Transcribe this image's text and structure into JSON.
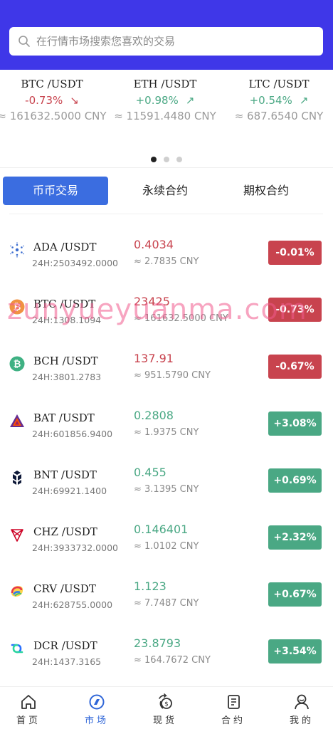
{
  "search": {
    "placeholder": "在行情市场搜索您喜欢的交易"
  },
  "tickers": [
    {
      "pair": "BTC /USDT",
      "change": "-0.73%",
      "direction": "down",
      "cny": "≈ 161632.5000 CNY"
    },
    {
      "pair": "ETH /USDT",
      "change": "+0.98%",
      "direction": "up",
      "cny": "≈ 11591.4480 CNY"
    },
    {
      "pair": "LTC /USDT",
      "change": "+0.54%",
      "direction": "up",
      "cny": "≈ 687.6540 CNY"
    }
  ],
  "tabs": [
    {
      "label": "币币交易",
      "active": true
    },
    {
      "label": "永续合约",
      "active": false
    },
    {
      "label": "期权合约",
      "active": false
    }
  ],
  "coins": [
    {
      "icon": "cardano-icon",
      "name": "ADA /USDT",
      "vol": "24H:2503492.0000",
      "price": "0.4034",
      "cny": "≈ 2.7835 CNY",
      "change": "-0.01%",
      "up": false
    },
    {
      "icon": "bitcoin-icon",
      "name": "BTC /USDT",
      "vol": "24H:1308.1094",
      "price": "23425",
      "cny": "≈ 161632.5000 CNY",
      "change": "-0.73%",
      "up": false
    },
    {
      "icon": "bitcoin-cash-icon",
      "name": "BCH /USDT",
      "vol": "24H:3801.2783",
      "price": "137.91",
      "cny": "≈ 951.5790 CNY",
      "change": "-0.67%",
      "up": false
    },
    {
      "icon": "bat-icon",
      "name": "BAT /USDT",
      "vol": "24H:601856.9400",
      "price": "0.2808",
      "cny": "≈ 1.9375 CNY",
      "change": "+3.08%",
      "up": true
    },
    {
      "icon": "bancor-icon",
      "name": "BNT /USDT",
      "vol": "24H:69921.1400",
      "price": "0.455",
      "cny": "≈ 3.1395 CNY",
      "change": "+0.69%",
      "up": true
    },
    {
      "icon": "chiliz-icon",
      "name": "CHZ /USDT",
      "vol": "24H:3933732.0000",
      "price": "0.146401",
      "cny": "≈ 1.0102 CNY",
      "change": "+2.32%",
      "up": true
    },
    {
      "icon": "curve-icon",
      "name": "CRV /USDT",
      "vol": "24H:628755.0000",
      "price": "1.123",
      "cny": "≈ 7.7487 CNY",
      "change": "+0.67%",
      "up": true
    },
    {
      "icon": "decred-icon",
      "name": "DCR /USDT",
      "vol": "24H:1437.3165",
      "price": "23.8793",
      "cny": "≈ 164.7672 CNY",
      "change": "+3.54%",
      "up": true
    }
  ],
  "watermark": "zunyueyuanma.com",
  "nav": [
    {
      "label": "首页",
      "icon": "home-icon",
      "active": false
    },
    {
      "label": "市场",
      "icon": "market-icon",
      "active": true
    },
    {
      "label": "现货",
      "icon": "spot-icon",
      "active": false
    },
    {
      "label": "合约",
      "icon": "contract-icon",
      "active": false
    },
    {
      "label": "我的",
      "icon": "profile-icon",
      "active": false
    }
  ],
  "colors": {
    "header": "#3f37e8",
    "up": "#4aa884",
    "down": "#c8434e",
    "tab_active": "#3b6de0",
    "nav_active": "#2f66d8"
  }
}
